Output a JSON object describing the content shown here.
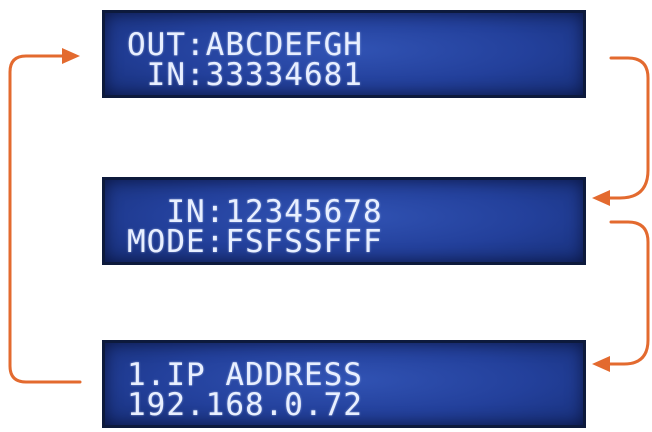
{
  "screens": [
    {
      "line1": "OUT:ABCDEFGH",
      "line2": " IN:33334681"
    },
    {
      "line1": "  IN:12345678",
      "line2": "MODE:FSFSSFFF"
    },
    {
      "line1": "1.IP ADDRESS",
      "line2": "192.168.0.72"
    }
  ],
  "colors": {
    "arrow": "#e36a2f",
    "lcd_background": "#23409b",
    "lcd_text": "#e8efff",
    "lcd_border": "#0d1a3c"
  }
}
